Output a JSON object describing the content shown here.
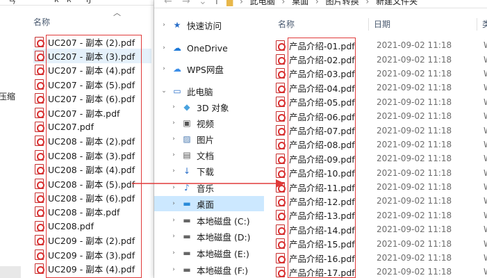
{
  "left_window": {
    "top_fragments": [
      "ㄢ",
      "ʀ",
      "ʀ",
      "ŋ",
      "ᵓ"
    ],
    "column_name": "名称",
    "sort_icon": "chevron-up-icon",
    "side_text": "压缩",
    "files": [
      "UC207 - 副本 (2).pdf",
      "UC207 - 副本 (3).pdf",
      "UC207 - 副本 (4).pdf",
      "UC207 - 副本 (5).pdf",
      "UC207 - 副本 (6).pdf",
      "UC207 - 副本.pdf",
      "UC207.pdf",
      "UC208 - 副本 (2).pdf",
      "UC208 - 副本 (3).pdf",
      "UC208 - 副本 (4).pdf",
      "UC208 - 副本 (5).pdf",
      "UC208 - 副本 (6).pdf",
      "UC208 - 副本.pdf",
      "UC208.pdf",
      "UC209 - 副本 (2).pdf",
      "UC209 - 副本 (3).pdf",
      "UC209 - 副本 (4).pdf"
    ]
  },
  "right_window": {
    "address": {
      "crumbs": [
        "此电脑",
        "桌面",
        "图片转换",
        "新建文件夹"
      ]
    },
    "nav": [
      {
        "label": "快速访问",
        "icon": "star-icon",
        "chevron": "›"
      },
      {
        "label": "OneDrive",
        "icon": "cloud-icon",
        "chevron": "›"
      },
      {
        "label": "WPS网盘",
        "icon": "wps-cloud-icon",
        "chevron": "›"
      },
      {
        "label": "此电脑",
        "icon": "computer-icon",
        "chevron": "⌄"
      },
      {
        "label": "3D 对象",
        "icon": "cube-icon",
        "chevron": "›"
      },
      {
        "label": "视频",
        "icon": "video-icon",
        "chevron": "›"
      },
      {
        "label": "图片",
        "icon": "picture-icon",
        "chevron": "›"
      },
      {
        "label": "文档",
        "icon": "document-icon",
        "chevron": "›"
      },
      {
        "label": "下载",
        "icon": "download-icon",
        "chevron": "›"
      },
      {
        "label": "音乐",
        "icon": "music-icon",
        "chevron": "›"
      },
      {
        "label": "桌面",
        "icon": "desktop-icon",
        "chevron": "›"
      },
      {
        "label": "本地磁盘 (C:)",
        "icon": "drive-icon",
        "chevron": "›"
      },
      {
        "label": "本地磁盘 (D:)",
        "icon": "drive-icon",
        "chevron": "›"
      },
      {
        "label": "本地磁盘 (E:)",
        "icon": "drive-icon",
        "chevron": "›"
      },
      {
        "label": "本地磁盘 (F:)",
        "icon": "drive-icon",
        "chevron": "›"
      }
    ],
    "columns": {
      "name": "名称",
      "date": "日期",
      "type": "类"
    },
    "files": [
      {
        "name": "产品介绍-01.pdf",
        "date": "2021-09-02 11:18",
        "type": "W"
      },
      {
        "name": "产品介绍-02.pdf",
        "date": "2021-09-02 11:18",
        "type": "W"
      },
      {
        "name": "产品介绍-03.pdf",
        "date": "2021-09-02 11:18",
        "type": "W"
      },
      {
        "name": "产品介绍-04.pdf",
        "date": "2021-09-02 11:18",
        "type": "W"
      },
      {
        "name": "产品介绍-05.pdf",
        "date": "2021-09-02 11:18",
        "type": "W"
      },
      {
        "name": "产品介绍-06.pdf",
        "date": "2021-09-02 11:18",
        "type": "W"
      },
      {
        "name": "产品介绍-07.pdf",
        "date": "2021-09-02 11:18",
        "type": "W"
      },
      {
        "name": "产品介绍-08.pdf",
        "date": "2021-09-02 11:18",
        "type": "W"
      },
      {
        "name": "产品介绍-09.pdf",
        "date": "2021-09-02 11:18",
        "type": "W"
      },
      {
        "name": "产品介绍-10.pdf",
        "date": "2021-09-02 11:18",
        "type": "W"
      },
      {
        "name": "产品介绍-11.pdf",
        "date": "2021-09-02 11:18",
        "type": "W"
      },
      {
        "name": "产品介绍-12.pdf",
        "date": "2021-09-02 11:18",
        "type": "W"
      },
      {
        "name": "产品介绍-13.pdf",
        "date": "2021-09-02 11:18",
        "type": "W"
      },
      {
        "name": "产品介绍-14.pdf",
        "date": "2021-09-02 11:18",
        "type": "W"
      },
      {
        "name": "产品介绍-15.pdf",
        "date": "2021-09-02 11:18",
        "type": "W"
      },
      {
        "name": "产品介绍-16.pdf",
        "date": "2021-09-02 11:18",
        "type": "W"
      },
      {
        "name": "产品介绍-17.pdf",
        "date": "2021-09-02 11:18",
        "type": "W"
      }
    ]
  },
  "colors": {
    "annotation": "#e03a3a",
    "selection": "#cce8ff",
    "pdf_red": "#d93030"
  }
}
